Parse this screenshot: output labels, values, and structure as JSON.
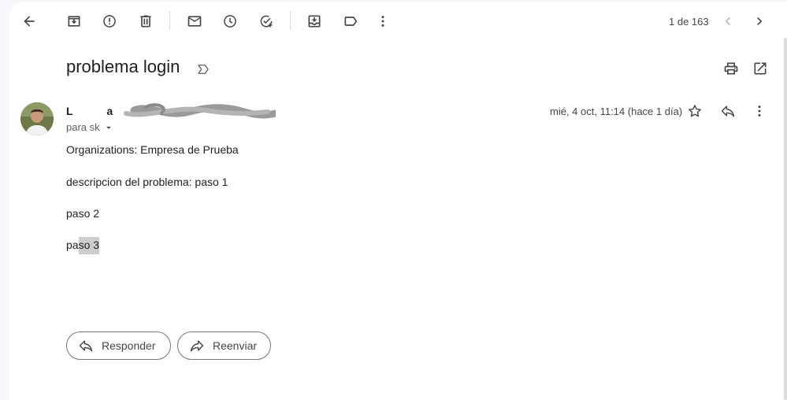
{
  "toolbar": {
    "icons": [
      "back-arrow-icon",
      "archive-icon",
      "report-spam-icon",
      "delete-icon",
      "mark-unread-icon",
      "snooze-icon",
      "add-to-tasks-icon",
      "move-to-icon",
      "label-icon",
      "more-vert-icon"
    ]
  },
  "pager": {
    "text": "1 de 163"
  },
  "email": {
    "subject": "problema login",
    "sender": "L           a",
    "to": "para sk",
    "date": "mié, 4 oct, 11:14 (hace 1 día)",
    "body": [
      "Organizations: Empresa de Prueba",
      "descripcion del problema: paso 1",
      "paso 2"
    ],
    "last_line_prefix": "pa",
    "last_line_selected": "so 3"
  },
  "actions": {
    "reply": "Responder",
    "forward": "Reenviar"
  }
}
